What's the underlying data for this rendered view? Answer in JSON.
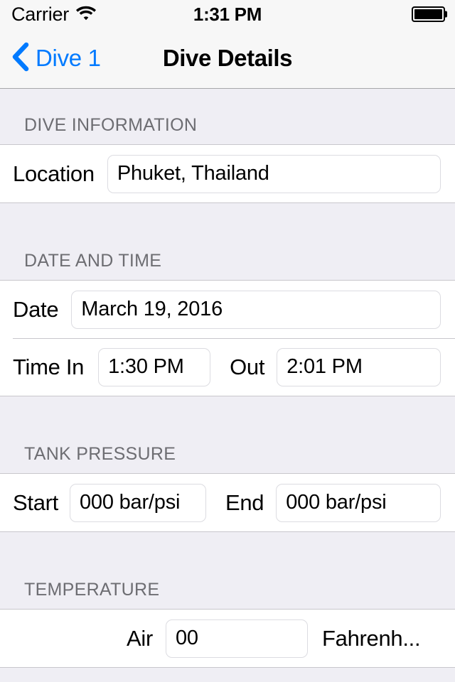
{
  "status_bar": {
    "carrier": "Carrier",
    "time": "1:31 PM",
    "wifi_icon": "wifi-icon",
    "battery_icon": "battery-full-icon"
  },
  "nav_bar": {
    "back_icon": "chevron-left-icon",
    "back_label": "Dive 1",
    "title": "Dive Details",
    "tint_color": "#007aff"
  },
  "sections": {
    "dive_information": {
      "header": "DIVE INFORMATION",
      "location": {
        "label": "Location",
        "value": "Phuket, Thailand"
      }
    },
    "date_and_time": {
      "header": "DATE AND TIME",
      "date": {
        "label": "Date",
        "value": "March 19, 2016"
      },
      "time_in": {
        "label": "Time In",
        "value": "1:30 PM"
      },
      "time_out": {
        "label": "Out",
        "value": "2:01 PM"
      }
    },
    "tank_pressure": {
      "header": "TANK PRESSURE",
      "start": {
        "label": "Start",
        "value": "000 bar/psi"
      },
      "end": {
        "label": "End",
        "value": "000 bar/psi"
      }
    },
    "temperature": {
      "header": "TEMPERATURE",
      "air": {
        "label": "Air",
        "value": "00"
      },
      "unit": "Fahrenh..."
    }
  }
}
